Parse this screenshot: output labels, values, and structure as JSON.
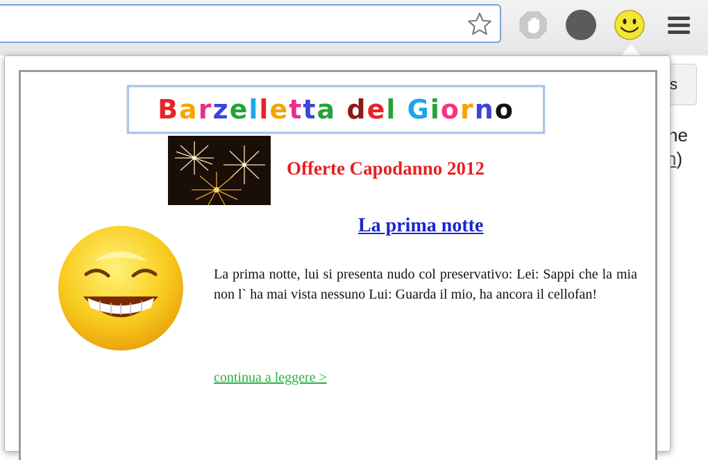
{
  "browser": {
    "toolbar_icons": [
      "star-icon",
      "stop-hand-icon",
      "gray-circle-icon",
      "smiley-extension-icon",
      "hamburger-menu-icon"
    ]
  },
  "background_page": {
    "button_label": "s",
    "text_line1": "ne",
    "text_line2_underlined": "n",
    "text_line2_rest": ")"
  },
  "popup": {
    "banner": {
      "letters": [
        "B",
        "a",
        "r",
        "z",
        "e",
        "l",
        "l",
        "e",
        "t",
        "t",
        "a",
        " ",
        "d",
        "e",
        "l",
        " ",
        "G",
        "i",
        "o",
        "r",
        "n",
        "o"
      ],
      "colors": [
        "#e8232a",
        "#f6a400",
        "#e82f8c",
        "#3a46d8",
        "#24a33a",
        "#1da6e8",
        "#e8232a",
        "#f6a400",
        "#e82f8c",
        "#3a46d8",
        "#24a33a",
        "",
        "#8b1a1a",
        "#e8232a",
        "#24a33a",
        "",
        "#1da6e8",
        "#24a33a",
        "#ff2f7a",
        "#f6a400",
        "#3a46d8",
        "#111111"
      ]
    },
    "offer_text": "Offerte Capodanno 2012",
    "joke_title": "La prima notte",
    "joke_body": "La prima notte, lui si presenta nudo col preservativo: Lei: Sappi che la mia non l` ha mai vista nessuno Lui: Guarda il mio, ha ancora il cellofan!",
    "read_more": "continua a leggere >"
  },
  "colors": {
    "offer": "#e8201f",
    "title_link": "#1b27c9",
    "read_more_link": "#27b23f",
    "omnibox_border": "#7aa3e0",
    "banner_border": "#a9c6ec"
  }
}
